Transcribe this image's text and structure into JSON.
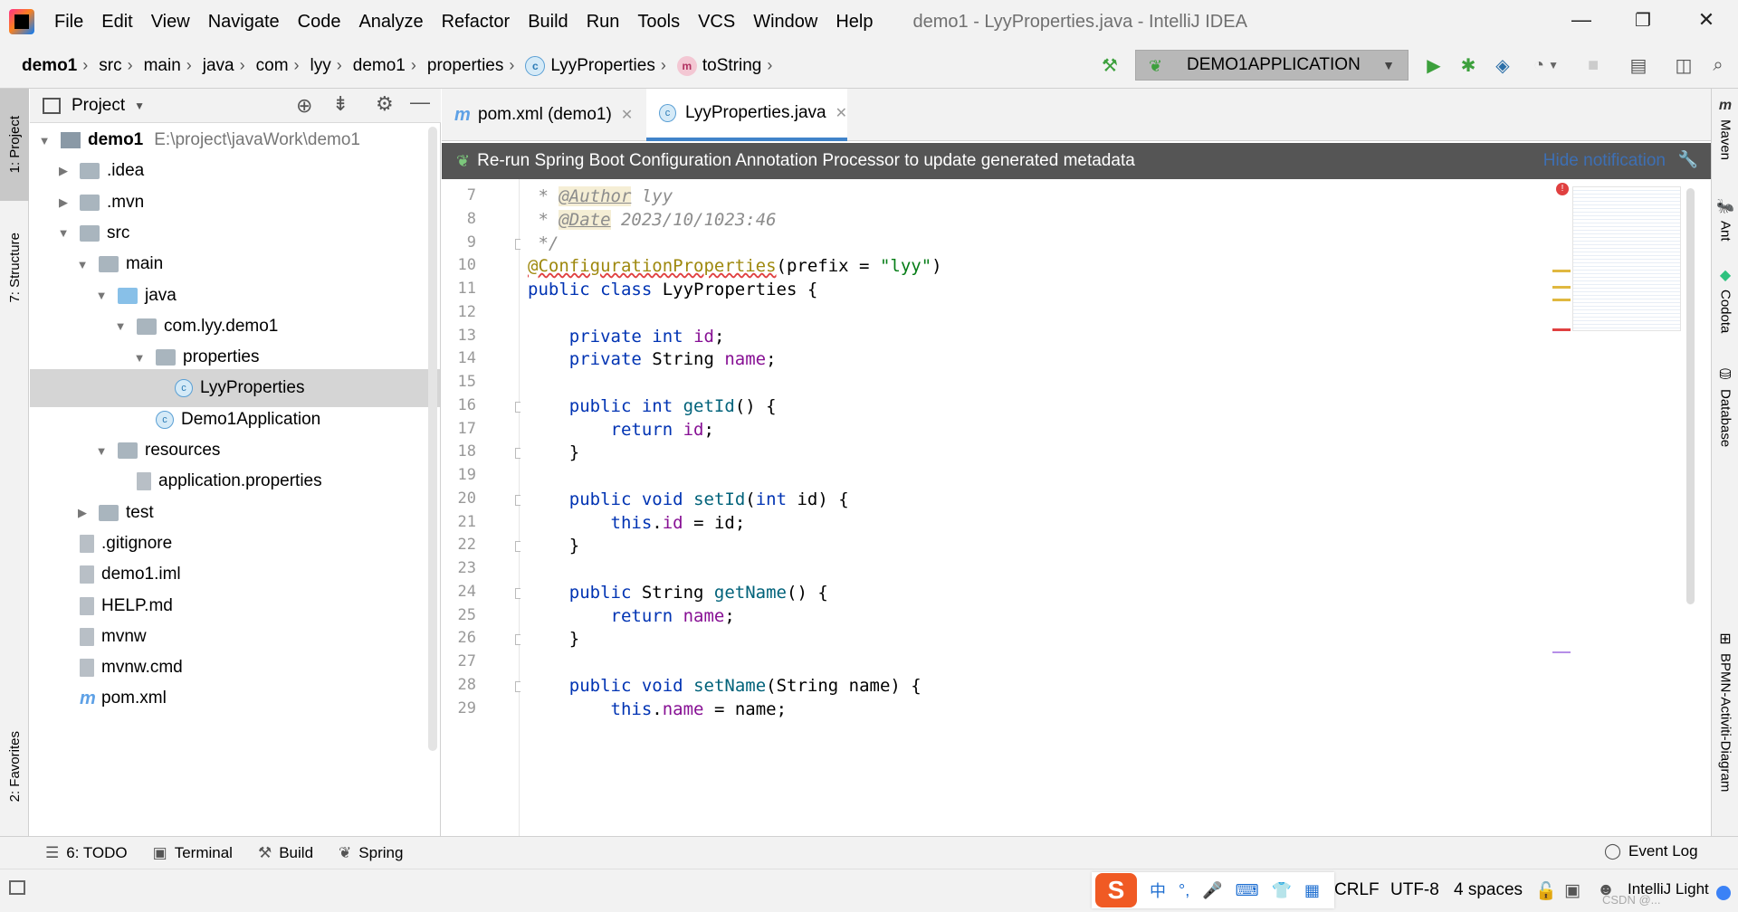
{
  "window": {
    "title": "demo1 - LyyProperties.java - IntelliJ IDEA",
    "controls": {
      "minimize": "—",
      "maximize": "❐",
      "close": "✕"
    }
  },
  "menu": [
    "File",
    "Edit",
    "View",
    "Navigate",
    "Code",
    "Analyze",
    "Refactor",
    "Build",
    "Run",
    "Tools",
    "VCS",
    "Window",
    "Help"
  ],
  "breadcrumbs": [
    "demo1",
    "src",
    "main",
    "java",
    "com",
    "lyy",
    "demo1",
    "properties",
    "LyyProperties",
    "toString"
  ],
  "toolbar": {
    "run_config": "DEMO1APPLICATION",
    "icons": [
      "hammer-icon",
      "run-icon",
      "debug-icon",
      "coverage-icon",
      "profile-icon",
      "stop-icon",
      "project-structure-icon",
      "layout-icon",
      "search-icon"
    ]
  },
  "left_tool_tabs": [
    "1: Project",
    "7: Structure",
    "2: Favorites"
  ],
  "right_tool_tabs": [
    "Maven",
    "Ant",
    "Codota",
    "Database",
    "BPMN-Activiti-Diagram"
  ],
  "project_panel": {
    "title": "Project",
    "tree": [
      {
        "label": "demo1",
        "path": "E:\\project\\javaWork\\demo1",
        "depth": 0,
        "arrow": "▼",
        "icon": "module",
        "bold": true
      },
      {
        "label": ".idea",
        "depth": 1,
        "arrow": "▶",
        "icon": "folder"
      },
      {
        "label": ".mvn",
        "depth": 1,
        "arrow": "▶",
        "icon": "folder"
      },
      {
        "label": "src",
        "depth": 1,
        "arrow": "▼",
        "icon": "folder"
      },
      {
        "label": "main",
        "depth": 2,
        "arrow": "▼",
        "icon": "folder"
      },
      {
        "label": "java",
        "depth": 3,
        "arrow": "▼",
        "icon": "folder-blue"
      },
      {
        "label": "com.lyy.demo1",
        "depth": 4,
        "arrow": "▼",
        "icon": "package"
      },
      {
        "label": "properties",
        "depth": 5,
        "arrow": "▼",
        "icon": "package"
      },
      {
        "label": "LyyProperties",
        "depth": 6,
        "arrow": "",
        "icon": "class",
        "selected": true
      },
      {
        "label": "Demo1Application",
        "depth": 5,
        "arrow": "",
        "icon": "class"
      },
      {
        "label": "resources",
        "depth": 3,
        "arrow": "▼",
        "icon": "folder"
      },
      {
        "label": "application.properties",
        "depth": 4,
        "arrow": "",
        "icon": "file"
      },
      {
        "label": "test",
        "depth": 2,
        "arrow": "▶",
        "icon": "folder"
      },
      {
        "label": ".gitignore",
        "depth": 1,
        "arrow": "",
        "icon": "file"
      },
      {
        "label": "demo1.iml",
        "depth": 1,
        "arrow": "",
        "icon": "file"
      },
      {
        "label": "HELP.md",
        "depth": 1,
        "arrow": "",
        "icon": "file"
      },
      {
        "label": "mvnw",
        "depth": 1,
        "arrow": "",
        "icon": "file"
      },
      {
        "label": "mvnw.cmd",
        "depth": 1,
        "arrow": "",
        "icon": "file"
      },
      {
        "label": "pom.xml",
        "depth": 1,
        "arrow": "",
        "icon": "maven"
      }
    ]
  },
  "editor": {
    "tabs": [
      {
        "label": "pom.xml (demo1)",
        "icon": "m",
        "active": false
      },
      {
        "label": "LyyProperties.java",
        "icon": "c",
        "active": true
      }
    ],
    "notification": "Re-run Spring Boot Configuration Annotation Processor to update generated metadata",
    "notification_action": "Hide notification",
    "lines": [
      {
        "n": "7",
        "html": " <span class=\"cmt\">* </span><span class=\"tag\">@Author</span><span class=\"cmt\"> lyy</span>"
      },
      {
        "n": "8",
        "html": " <span class=\"cmt\">* </span><span class=\"tag\">@Date</span><span class=\"cmt\"> 2023/10/1023:46</span>"
      },
      {
        "n": "9",
        "html": " <span class=\"cmt\">*/</span>"
      },
      {
        "n": "10",
        "html": "<span class=\"ann err\">@ConfigurationProperties</span>(prefix = <span class=\"str\">\"lyy\"</span>)"
      },
      {
        "n": "11",
        "html": "<span class=\"kw\">public class</span> LyyProperties {"
      },
      {
        "n": "12",
        "html": ""
      },
      {
        "n": "13",
        "html": "    <span class=\"kw\">private int</span> <span class=\"fld\">id</span>;"
      },
      {
        "n": "14",
        "html": "    <span class=\"kw\">private</span> String <span class=\"fld\">name</span>;"
      },
      {
        "n": "15",
        "html": ""
      },
      {
        "n": "16",
        "html": "    <span class=\"kw\">public int</span> <span class=\"fn\">getId</span>() {"
      },
      {
        "n": "17",
        "html": "        <span class=\"kw\">return</span> <span class=\"fld\">id</span>;"
      },
      {
        "n": "18",
        "html": "    }"
      },
      {
        "n": "19",
        "html": ""
      },
      {
        "n": "20",
        "html": "    <span class=\"kw\">public void</span> <span class=\"fn\">setId</span>(<span class=\"kw\">int</span> id) {"
      },
      {
        "n": "21",
        "html": "        <span class=\"kw\">this</span>.<span class=\"fld\">id</span> = id;"
      },
      {
        "n": "22",
        "html": "    }"
      },
      {
        "n": "23",
        "html": ""
      },
      {
        "n": "24",
        "html": "    <span class=\"kw\">public</span> String <span class=\"fn\">getName</span>() {"
      },
      {
        "n": "25",
        "html": "        <span class=\"kw\">return</span> <span class=\"fld\">name</span>;"
      },
      {
        "n": "26",
        "html": "    }"
      },
      {
        "n": "27",
        "html": ""
      },
      {
        "n": "28",
        "html": "    <span class=\"kw\">public void</span> <span class=\"fn\">setName</span>(String name) {"
      },
      {
        "n": "29",
        "html": "        <span class=\"kw\">this</span>.<span class=\"fld\">name</span> = name;"
      }
    ]
  },
  "bottom_tools": [
    {
      "label": "6: TODO",
      "icon": "☰"
    },
    {
      "label": "Terminal",
      "icon": "▣"
    },
    {
      "label": "Build",
      "icon": "⚒"
    },
    {
      "label": "Spring",
      "icon": "❦"
    }
  ],
  "event_log": "Event Log",
  "status": {
    "line_sep": "CRLF",
    "encoding": "UTF-8",
    "indent": "4 spaces",
    "theme": "IntelliJ Light",
    "watermark": "CSDN @...",
    "ime_logo": "S",
    "ime_icons": [
      "中",
      "°,",
      "🎤",
      "⌨",
      "👕",
      "▦"
    ]
  },
  "colors": {
    "accent": "#4083c9",
    "keyword": "#0033b3",
    "field": "#871094",
    "method": "#00627a",
    "string": "#067d17",
    "annotation": "#9e880d",
    "run_green": "#3ca03c"
  }
}
